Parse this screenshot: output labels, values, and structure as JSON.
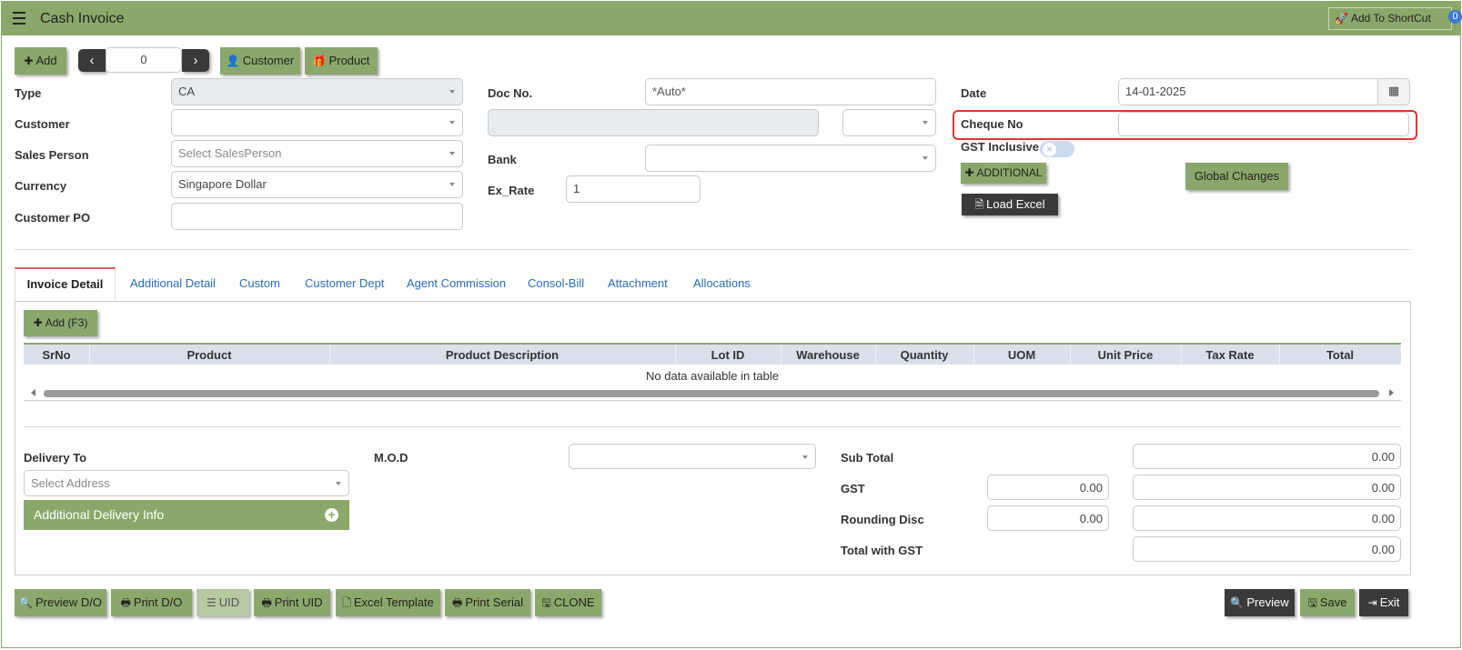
{
  "app": {
    "title": "Cash Invoice",
    "shortcut_label": "Add To ShortCut",
    "shortcut_count": "0"
  },
  "toolbar": {
    "add_label": "Add",
    "nav_value": "0",
    "customer_label": "Customer",
    "product_label": "Product"
  },
  "form": {
    "type_label": "Type",
    "type_value": "CA",
    "customer_label": "Customer",
    "sales_person_label": "Sales Person",
    "sales_person_placeholder": "Select SalesPerson",
    "currency_label": "Currency",
    "currency_value": "Singapore Dollar",
    "customer_po_label": "Customer PO",
    "doc_no_label": "Doc No.",
    "doc_no_value": "*Auto*",
    "bank_label": "Bank",
    "ex_rate_label": "Ex_Rate",
    "ex_rate_value": "1",
    "date_label": "Date",
    "date_value": "14-01-2025",
    "cheque_no_label": "Cheque No",
    "gst_inclusive_label": "GST Inclusive",
    "additional_label": "ADDITIONAL",
    "global_changes_label": "Global Changes",
    "load_excel_label": "Load Excel"
  },
  "tabs": [
    "Invoice Detail",
    "Additional Detail",
    "Custom",
    "Customer Dept",
    "Agent Commission",
    "Consol-Bill",
    "Attachment",
    "Allocations"
  ],
  "grid": {
    "add_label": "Add (F3)",
    "columns": [
      "SrNo",
      "Product",
      "Product Description",
      "Lot ID",
      "Warehouse",
      "Quantity",
      "UOM",
      "Unit Price",
      "Tax Rate",
      "Total"
    ],
    "empty_text": "No data available in table"
  },
  "footer": {
    "delivery_to_label": "Delivery To",
    "address_placeholder": "Select Address",
    "additional_delivery_label": "Additional Delivery Info",
    "mod_label": "M.O.D",
    "sub_total_label": "Sub Total",
    "sub_total_value": "0.00",
    "gst_label": "GST",
    "gst_rate_value": "0.00",
    "gst_value": "0.00",
    "rounding_label": "Rounding Disc",
    "rounding_rate_value": "0.00",
    "rounding_value": "0.00",
    "total_gst_label": "Total with GST",
    "total_gst_value": "0.00"
  },
  "actions": {
    "preview_do": "Preview D/O",
    "print_do": "Print D/O",
    "uid": "UID",
    "print_uid": "Print UID",
    "excel_template": "Excel Template",
    "print_serial": "Print Serial",
    "clone": "CLONE",
    "preview": "Preview",
    "save": "Save",
    "exit": "Exit"
  },
  "colors": {
    "accent": "#8aa86b",
    "dark_button": "#3a3a3a",
    "link": "#2a6bb5",
    "highlight": "#e8332c"
  }
}
